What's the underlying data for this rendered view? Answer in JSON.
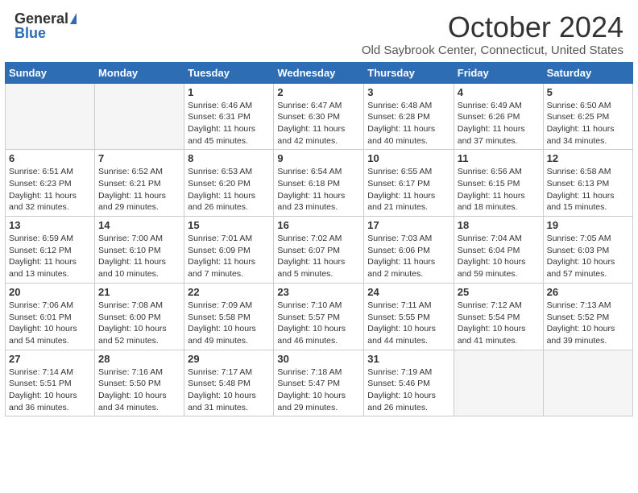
{
  "logo": {
    "general": "General",
    "blue": "Blue"
  },
  "title": "October 2024",
  "location": "Old Saybrook Center, Connecticut, United States",
  "days_of_week": [
    "Sunday",
    "Monday",
    "Tuesday",
    "Wednesday",
    "Thursday",
    "Friday",
    "Saturday"
  ],
  "weeks": [
    [
      {
        "day": "",
        "detail": ""
      },
      {
        "day": "",
        "detail": ""
      },
      {
        "day": "1",
        "detail": "Sunrise: 6:46 AM\nSunset: 6:31 PM\nDaylight: 11 hours and 45 minutes."
      },
      {
        "day": "2",
        "detail": "Sunrise: 6:47 AM\nSunset: 6:30 PM\nDaylight: 11 hours and 42 minutes."
      },
      {
        "day": "3",
        "detail": "Sunrise: 6:48 AM\nSunset: 6:28 PM\nDaylight: 11 hours and 40 minutes."
      },
      {
        "day": "4",
        "detail": "Sunrise: 6:49 AM\nSunset: 6:26 PM\nDaylight: 11 hours and 37 minutes."
      },
      {
        "day": "5",
        "detail": "Sunrise: 6:50 AM\nSunset: 6:25 PM\nDaylight: 11 hours and 34 minutes."
      }
    ],
    [
      {
        "day": "6",
        "detail": "Sunrise: 6:51 AM\nSunset: 6:23 PM\nDaylight: 11 hours and 32 minutes."
      },
      {
        "day": "7",
        "detail": "Sunrise: 6:52 AM\nSunset: 6:21 PM\nDaylight: 11 hours and 29 minutes."
      },
      {
        "day": "8",
        "detail": "Sunrise: 6:53 AM\nSunset: 6:20 PM\nDaylight: 11 hours and 26 minutes."
      },
      {
        "day": "9",
        "detail": "Sunrise: 6:54 AM\nSunset: 6:18 PM\nDaylight: 11 hours and 23 minutes."
      },
      {
        "day": "10",
        "detail": "Sunrise: 6:55 AM\nSunset: 6:17 PM\nDaylight: 11 hours and 21 minutes."
      },
      {
        "day": "11",
        "detail": "Sunrise: 6:56 AM\nSunset: 6:15 PM\nDaylight: 11 hours and 18 minutes."
      },
      {
        "day": "12",
        "detail": "Sunrise: 6:58 AM\nSunset: 6:13 PM\nDaylight: 11 hours and 15 minutes."
      }
    ],
    [
      {
        "day": "13",
        "detail": "Sunrise: 6:59 AM\nSunset: 6:12 PM\nDaylight: 11 hours and 13 minutes."
      },
      {
        "day": "14",
        "detail": "Sunrise: 7:00 AM\nSunset: 6:10 PM\nDaylight: 11 hours and 10 minutes."
      },
      {
        "day": "15",
        "detail": "Sunrise: 7:01 AM\nSunset: 6:09 PM\nDaylight: 11 hours and 7 minutes."
      },
      {
        "day": "16",
        "detail": "Sunrise: 7:02 AM\nSunset: 6:07 PM\nDaylight: 11 hours and 5 minutes."
      },
      {
        "day": "17",
        "detail": "Sunrise: 7:03 AM\nSunset: 6:06 PM\nDaylight: 11 hours and 2 minutes."
      },
      {
        "day": "18",
        "detail": "Sunrise: 7:04 AM\nSunset: 6:04 PM\nDaylight: 10 hours and 59 minutes."
      },
      {
        "day": "19",
        "detail": "Sunrise: 7:05 AM\nSunset: 6:03 PM\nDaylight: 10 hours and 57 minutes."
      }
    ],
    [
      {
        "day": "20",
        "detail": "Sunrise: 7:06 AM\nSunset: 6:01 PM\nDaylight: 10 hours and 54 minutes."
      },
      {
        "day": "21",
        "detail": "Sunrise: 7:08 AM\nSunset: 6:00 PM\nDaylight: 10 hours and 52 minutes."
      },
      {
        "day": "22",
        "detail": "Sunrise: 7:09 AM\nSunset: 5:58 PM\nDaylight: 10 hours and 49 minutes."
      },
      {
        "day": "23",
        "detail": "Sunrise: 7:10 AM\nSunset: 5:57 PM\nDaylight: 10 hours and 46 minutes."
      },
      {
        "day": "24",
        "detail": "Sunrise: 7:11 AM\nSunset: 5:55 PM\nDaylight: 10 hours and 44 minutes."
      },
      {
        "day": "25",
        "detail": "Sunrise: 7:12 AM\nSunset: 5:54 PM\nDaylight: 10 hours and 41 minutes."
      },
      {
        "day": "26",
        "detail": "Sunrise: 7:13 AM\nSunset: 5:52 PM\nDaylight: 10 hours and 39 minutes."
      }
    ],
    [
      {
        "day": "27",
        "detail": "Sunrise: 7:14 AM\nSunset: 5:51 PM\nDaylight: 10 hours and 36 minutes."
      },
      {
        "day": "28",
        "detail": "Sunrise: 7:16 AM\nSunset: 5:50 PM\nDaylight: 10 hours and 34 minutes."
      },
      {
        "day": "29",
        "detail": "Sunrise: 7:17 AM\nSunset: 5:48 PM\nDaylight: 10 hours and 31 minutes."
      },
      {
        "day": "30",
        "detail": "Sunrise: 7:18 AM\nSunset: 5:47 PM\nDaylight: 10 hours and 29 minutes."
      },
      {
        "day": "31",
        "detail": "Sunrise: 7:19 AM\nSunset: 5:46 PM\nDaylight: 10 hours and 26 minutes."
      },
      {
        "day": "",
        "detail": ""
      },
      {
        "day": "",
        "detail": ""
      }
    ]
  ]
}
